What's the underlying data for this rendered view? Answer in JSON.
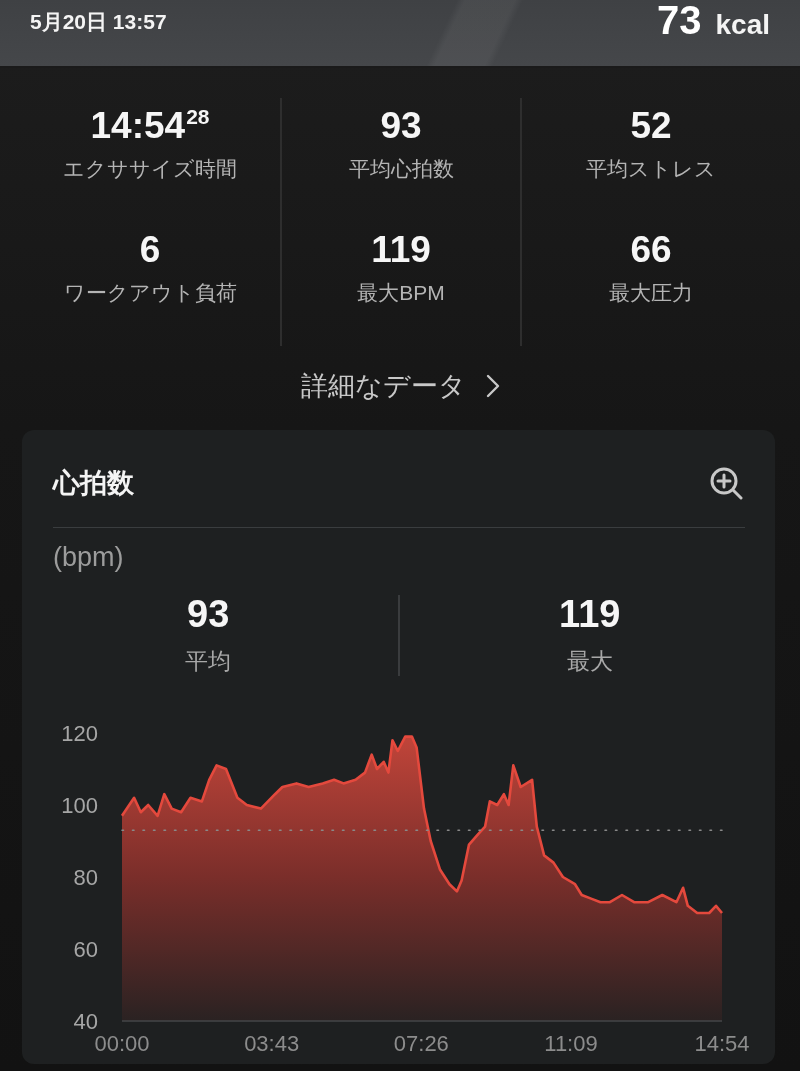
{
  "header": {
    "date_time": "5月20日 13:57",
    "calories": "73",
    "calories_unit": "kcal"
  },
  "summary_stats": [
    {
      "value": "14:54$^{28}$",
      "label": "エクササイズ時間"
    },
    {
      "value": "93",
      "label": "平均心拍数"
    },
    {
      "value": "52",
      "label": "平均ストレス"
    },
    {
      "value": "6",
      "label": "ワークアウト負荷"
    },
    {
      "value": "119",
      "label": "最大BPM"
    },
    {
      "value": "66",
      "label": "最大圧力"
    }
  ],
  "details_link": {
    "label": "詳細なデータ"
  },
  "heart_rate_card": {
    "title": "心拍数",
    "unit": "(bpm)",
    "stats": [
      {
        "value": "93",
        "label": "平均"
      },
      {
        "value": "119",
        "label": "最大"
      }
    ],
    "chart_data": {
      "type": "area",
      "x": [
        0,
        18,
        28,
        39,
        53,
        63,
        74,
        88,
        102,
        119,
        130,
        141,
        155,
        172,
        186,
        207,
        228,
        239,
        260,
        278,
        299,
        316,
        330,
        348,
        362,
        372,
        380,
        390,
        397,
        403,
        411,
        422,
        432,
        439,
        450,
        460,
        474,
        488,
        499,
        506,
        517,
        531,
        541,
        548,
        559,
        569,
        576,
        583,
        594,
        611,
        618,
        629,
        643,
        657,
        675,
        685,
        699,
        713,
        727,
        745,
        763,
        784,
        805,
        826,
        836,
        843,
        857,
        875,
        885,
        894
      ],
      "values": [
        97,
        102,
        98,
        100,
        97,
        103,
        99,
        98,
        102,
        101,
        107,
        111,
        110,
        102,
        100,
        99,
        103,
        105,
        106,
        105,
        106,
        107,
        106,
        107,
        109,
        114,
        110,
        112,
        109,
        118,
        115,
        119,
        119,
        116,
        99,
        90,
        82,
        78,
        76,
        79,
        89,
        92,
        94,
        101,
        100,
        103,
        100,
        111,
        105,
        107,
        94,
        86,
        84,
        80,
        78,
        75,
        74,
        73,
        73,
        75,
        73,
        73,
        75,
        73,
        77,
        72,
        70,
        70,
        72,
        70
      ],
      "xlim": [
        0,
        894
      ],
      "ylim": [
        40,
        120
      ],
      "xticks": [
        {
          "value": 0,
          "label": "00:00"
        },
        {
          "value": 223,
          "label": "03:43"
        },
        {
          "value": 446,
          "label": "07:26"
        },
        {
          "value": 669,
          "label": "11:09"
        },
        {
          "value": 894,
          "label": "14:54"
        }
      ],
      "yticks": [
        40,
        60,
        80,
        100,
        120
      ],
      "ref_lines": [
        {
          "axis": "y",
          "value": 93
        }
      ]
    }
  }
}
